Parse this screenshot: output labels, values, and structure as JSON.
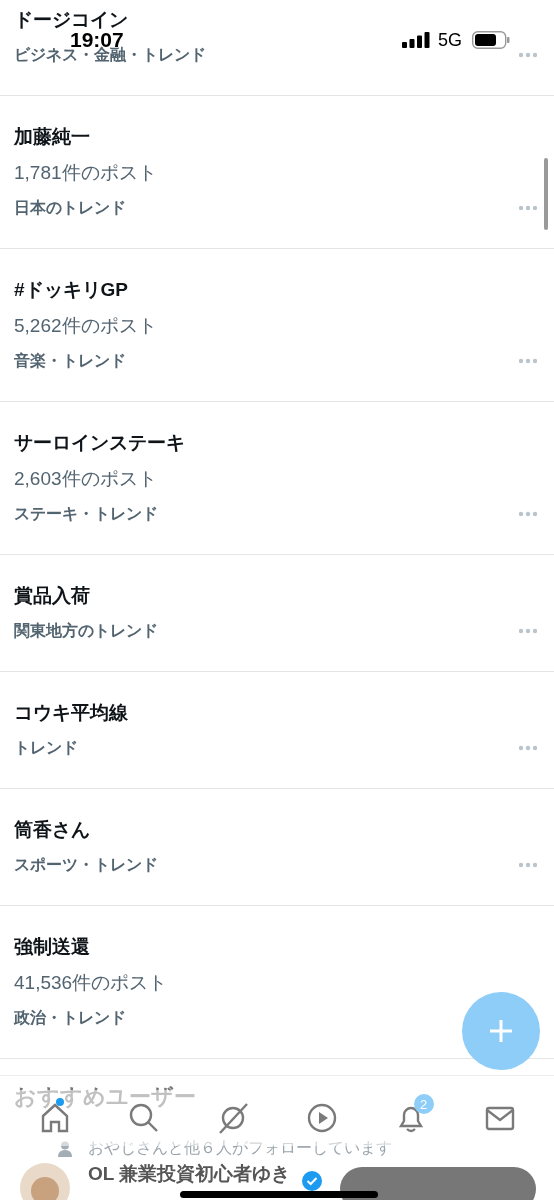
{
  "status_bar": {
    "time": "19:07",
    "network": "5G"
  },
  "trends": [
    {
      "title": "ドージコイン",
      "category": "ビジネス・金融・トレンド"
    },
    {
      "title": "加藤純一",
      "posts": "1,781件のポスト",
      "category": "日本のトレンド"
    },
    {
      "title": "#ドッキリGP",
      "posts": "5,262件のポスト",
      "category": "音楽・トレンド"
    },
    {
      "title": "サーロインステーキ",
      "posts": "2,603件のポスト",
      "category": "ステーキ・トレンド"
    },
    {
      "title": "賞品入荷",
      "category": "関東地方のトレンド"
    },
    {
      "title": "コウキ平均線",
      "category": "トレンド"
    },
    {
      "title": "筒香さん",
      "category": "スポーツ・トレンド"
    },
    {
      "title": "強制送還",
      "posts": "41,536件のポスト",
      "category": "政治・トレンド"
    }
  ],
  "section": {
    "title": "おすすめユーザー"
  },
  "nav": [
    {
      "kind": "home",
      "dot": true
    },
    {
      "kind": "search",
      "dot": false
    },
    {
      "kind": "grok",
      "dot": false
    },
    {
      "kind": "video",
      "dot": false
    },
    {
      "kind": "bell",
      "dot": false,
      "badge": "2"
    },
    {
      "kind": "mail",
      "dot": false
    }
  ],
  "suggested_user": {
    "followed_by": "おやじさんと他６人がフォローしています",
    "name": "OL 兼業投資初心者ゆき",
    "verified": true
  }
}
